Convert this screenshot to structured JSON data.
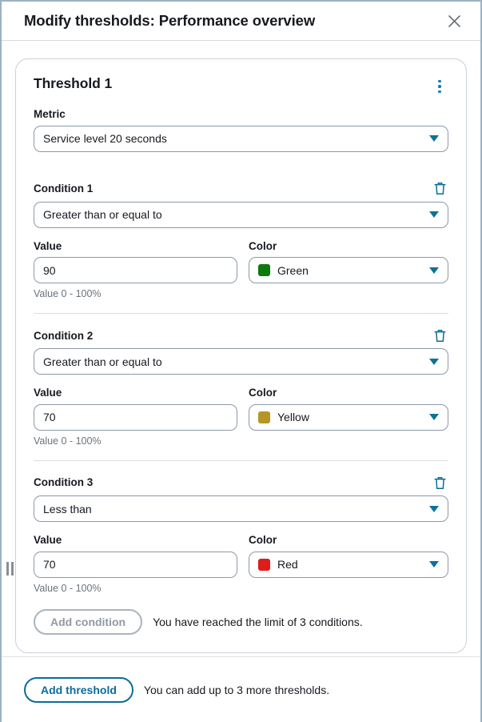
{
  "header": {
    "title": "Modify thresholds: Performance overview",
    "close_icon": "close-icon"
  },
  "drag_handle": {
    "icon": "drag-handle-icon"
  },
  "threshold": {
    "title": "Threshold 1",
    "menu_icon": "kebab-menu-icon",
    "metric": {
      "label": "Metric",
      "value": "Service level 20 seconds"
    },
    "conditions": [
      {
        "label": "Condition 1",
        "delete_icon": "trash-icon",
        "operator": "Greater than or equal to",
        "value_label": "Value",
        "value": "90",
        "helper": "Value 0 - 100%",
        "color_label": "Color",
        "color_name": "Green",
        "color_hex": "#0c7a0c"
      },
      {
        "label": "Condition 2",
        "delete_icon": "trash-icon",
        "operator": "Greater than or equal to",
        "value_label": "Value",
        "value": "70",
        "helper": "Value 0 - 100%",
        "color_label": "Color",
        "color_name": "Yellow",
        "color_hex": "#b59525"
      },
      {
        "label": "Condition 3",
        "delete_icon": "trash-icon",
        "operator": "Less than",
        "value_label": "Value",
        "value": "70",
        "helper": "Value 0 - 100%",
        "color_label": "Color",
        "color_name": "Red",
        "color_hex": "#e01b1b"
      }
    ],
    "add_condition": {
      "label": "Add condition",
      "disabled": true,
      "note": "You have reached the limit of 3 conditions."
    }
  },
  "footer": {
    "add_threshold": {
      "label": "Add threshold",
      "note": "You can add up to 3 more thresholds."
    }
  },
  "colors": {
    "accent": "#0b6c9a",
    "caret": "#0b7299",
    "border": "#8d99a8",
    "panel_border": "#9cb2c4",
    "text": "#16191f",
    "muted": "#6a737b"
  }
}
